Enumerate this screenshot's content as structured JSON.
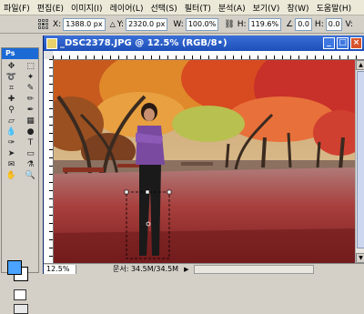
{
  "menu": [
    "파일(F)",
    "편집(E)",
    "이미지(I)",
    "레이어(L)",
    "선택(S)",
    "필터(T)",
    "분석(A)",
    "보기(V)",
    "창(W)",
    "도움말(H)"
  ],
  "options": {
    "x_label": "X:",
    "x_value": "1388.0 px",
    "y_label": "Y:",
    "y_value": "2320.0 px",
    "w_label": "W:",
    "w_value": "100.0%",
    "h_label": "H:",
    "h_value": "119.6%",
    "rot_value": "0.0",
    "hskew_label": "H:",
    "hskew_value": "0.0",
    "v_label": "V:"
  },
  "tools_panel": {
    "header": "Ps"
  },
  "document": {
    "title": "_DSC2378.JPG @ 12.5% (RGB/8•)",
    "status_zoom": "12.5%",
    "status_info": "문서: 34.5M/34.5M"
  },
  "colors": {
    "foreground": "#4aa3ff",
    "background": "#ffffff",
    "title_bar": "#1d4fb8"
  }
}
